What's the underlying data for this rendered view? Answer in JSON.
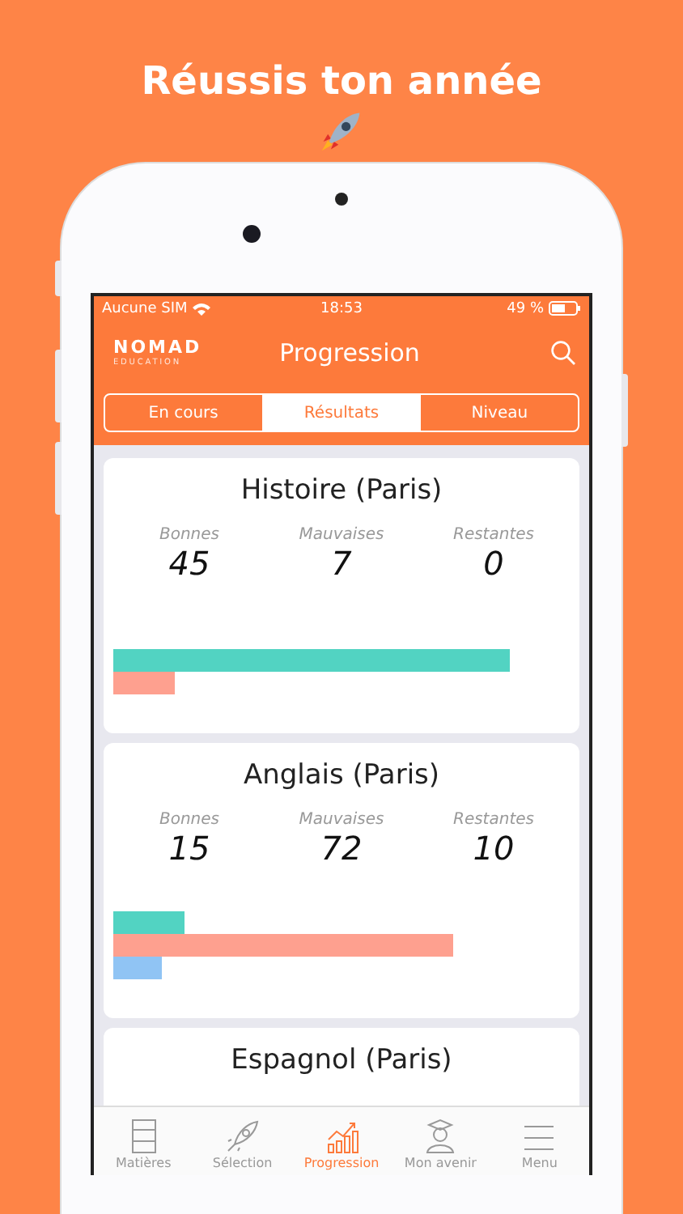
{
  "headline": "Réussis ton année",
  "status_bar": {
    "carrier": "Aucune SIM",
    "time": "18:53",
    "battery": "49 %"
  },
  "nav_bar": {
    "logo_top": "NOMAD",
    "logo_bottom": "EDUCATION",
    "title": "Progression"
  },
  "tabs": [
    {
      "label": "En cours",
      "selected": false
    },
    {
      "label": "Résultats",
      "selected": true
    },
    {
      "label": "Niveau",
      "selected": false
    }
  ],
  "cards": [
    {
      "title": "Histoire (Paris)",
      "stats": [
        {
          "label": "Bonnes",
          "value": "45"
        },
        {
          "label": "Mauvaises",
          "value": "7"
        },
        {
          "label": "Restantes",
          "value": "0"
        }
      ],
      "bars": [
        {
          "color": "#52d3c2",
          "level": 0.87
        },
        {
          "color": "#fea08f",
          "level": 0.135
        }
      ]
    },
    {
      "title": "Anglais (Paris)",
      "stats": [
        {
          "label": "Bonnes",
          "value": "15"
        },
        {
          "label": "Mauvaises",
          "value": "72"
        },
        {
          "label": "Restantes",
          "value": "10"
        }
      ],
      "bars": [
        {
          "color": "#52d3c2",
          "level": 0.155
        },
        {
          "color": "#fea08f",
          "level": 0.745
        },
        {
          "color": "#90c4f4",
          "level": 0.105
        }
      ]
    },
    {
      "title": "Espagnol (Paris)"
    }
  ],
  "tab_bar": [
    {
      "kind": "books",
      "label": "Matières",
      "selected": false
    },
    {
      "kind": "rocket",
      "label": "Sélection",
      "selected": false
    },
    {
      "kind": "chart",
      "label": "Progression",
      "selected": true
    },
    {
      "kind": "graduate",
      "label": "Mon avenir",
      "selected": false
    },
    {
      "kind": "menu",
      "label": "Menu",
      "selected": false
    }
  ]
}
